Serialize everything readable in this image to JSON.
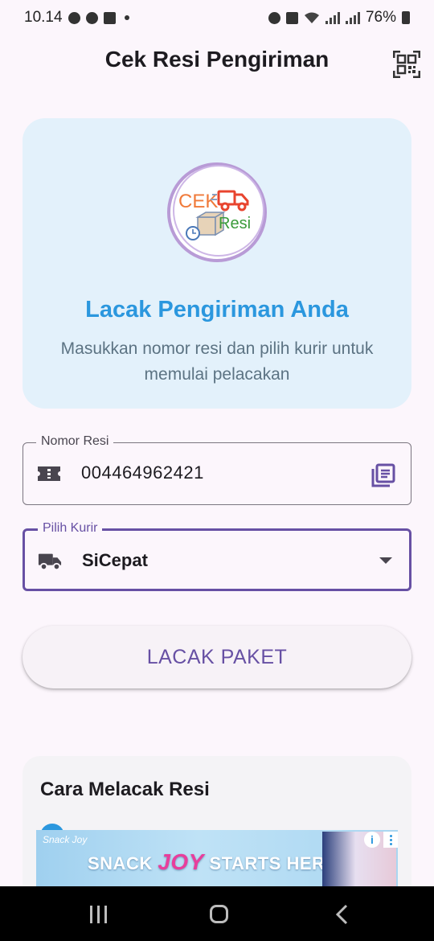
{
  "status_bar": {
    "time": "10.14",
    "battery": "76%"
  },
  "header": {
    "title": "Cek Resi Pengiriman",
    "qr_icon": "qr-scan-icon"
  },
  "hero": {
    "logo_text_top": "CEK",
    "logo_text_bottom": "Resi",
    "title": "Lacak Pengiriman Anda",
    "subtitle": "Masukkan nomor resi dan pilih kurir untuk memulai pelacakan"
  },
  "form": {
    "resi_label": "Nomor Resi",
    "resi_value": "004464962421",
    "resi_icon": "ticket-icon",
    "paste_icon": "paste-library-icon",
    "kurir_label": "Pilih Kurir",
    "kurir_value": "SiCepat",
    "kurir_icon": "truck-icon"
  },
  "track_button": {
    "label": "LACAK PAKET"
  },
  "howto": {
    "title": "Cara Melacak Resi"
  },
  "ad": {
    "brand": "Snack Joy",
    "text_before": "SNACK",
    "text_joy": "JOY",
    "text_after": "STARTS HERE"
  },
  "colors": {
    "accent": "#6750a4",
    "hero_title": "#2b97de",
    "hero_bg": "#e3f1fb",
    "background": "#fcf6fc"
  }
}
